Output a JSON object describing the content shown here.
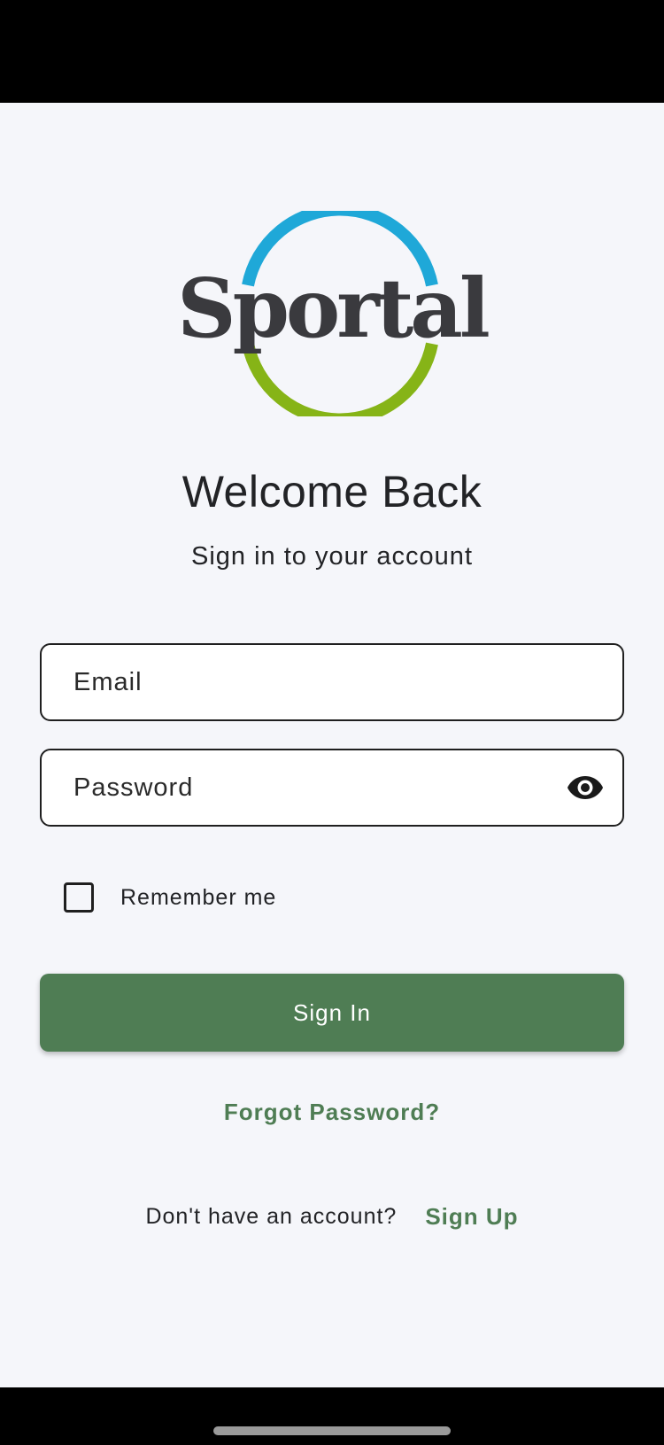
{
  "brand": {
    "logo_text": "Sportal",
    "colors": {
      "text": "#3A3A3E",
      "ring_top": "#1FA8D8",
      "ring_bottom": "#86B417"
    }
  },
  "header": {
    "title": "Welcome Back",
    "subtitle": "Sign in to your account"
  },
  "form": {
    "email": {
      "placeholder": "Email",
      "value": ""
    },
    "password": {
      "placeholder": "Password",
      "value": "",
      "toggle_icon": "eye-icon"
    },
    "remember": {
      "label": "Remember me",
      "checked": false
    },
    "signin_label": "Sign In",
    "forgot_label": "Forgot Password?"
  },
  "footer": {
    "prompt": "Don't have an account?",
    "signup_label": "Sign Up"
  },
  "theme": {
    "accent": "#4F7D54",
    "background": "#F5F6FA"
  }
}
